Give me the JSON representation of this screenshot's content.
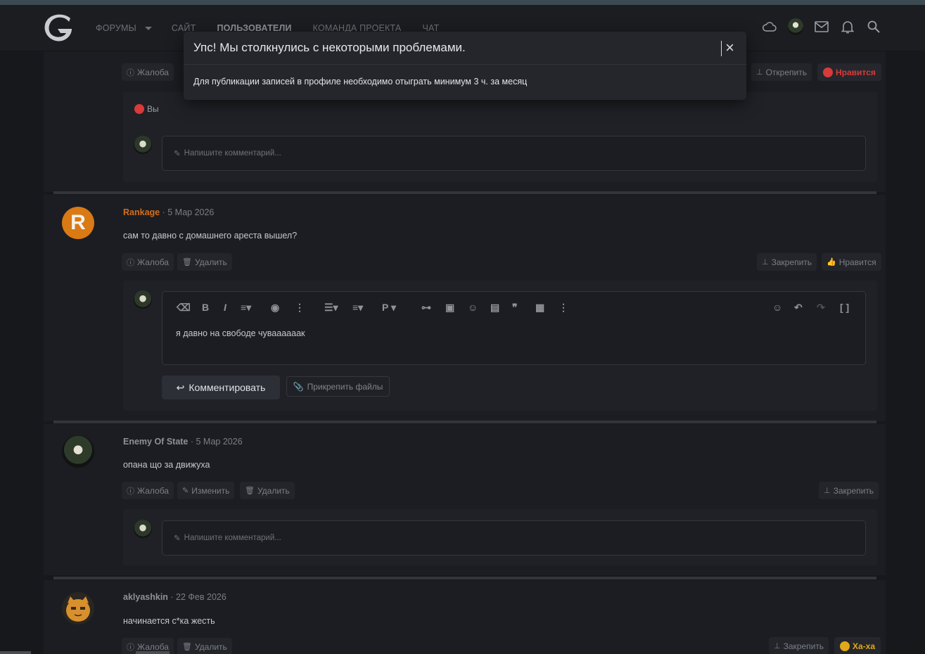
{
  "nav": {
    "items": [
      "ФОРУМЫ",
      "САЙТ",
      "ПОЛЬЗОВАТЕЛИ",
      "КОМАНДА ПРОЕКТА",
      "ЧАТ"
    ],
    "active_index": 2
  },
  "modal": {
    "title": "Упс! Мы столкнулись с некоторыми проблемами.",
    "message": "Для публикации записей в профиле необходимо отыграть минимум 3 ч. за месяц",
    "close_icon": "close-icon"
  },
  "top_post": {
    "report": "Жалоба",
    "unpin": "Открепить",
    "reaction": "Нравится",
    "likes_summary": "Вы",
    "comment_placeholder": "Напишите комментарий..."
  },
  "posts": [
    {
      "author": "Rankage",
      "date": "5 Мар 2026",
      "text": "сам то давно с домашнего ареста вышел?",
      "avatar_letter": "R",
      "author_color": "#d46e1a",
      "actions": [
        "Жалоба",
        "Удалить"
      ],
      "right_actions": [
        "Закрепить",
        "Нравится"
      ],
      "editor_text": "я давно на свободе чуваааааак",
      "submit": "Комментировать",
      "attach": "Прикрепить файлы"
    },
    {
      "author": "Enemy Of State",
      "date": "5 Мар 2026",
      "text": "опана що за движуха",
      "author_color": "#8d9197",
      "actions": [
        "Жалоба",
        "Изменить",
        "Удалить"
      ],
      "right_actions": [
        "Закрепить"
      ],
      "comment_placeholder": "Напишите комментарий..."
    },
    {
      "author": "aklyashkin",
      "date": "22 Фев 2026",
      "text": "начинается с*ка жесть",
      "author_color": "#8d9197",
      "actions": [
        "Жалоба",
        "Удалить"
      ],
      "right_actions": [
        "Закрепить"
      ],
      "reaction": "Ха-ха"
    }
  ],
  "colors": {
    "like_red": "#d93a3a",
    "haha_yellow": "#e0a91a",
    "accent_orange": "#d46e1a"
  },
  "date_sep": " · "
}
